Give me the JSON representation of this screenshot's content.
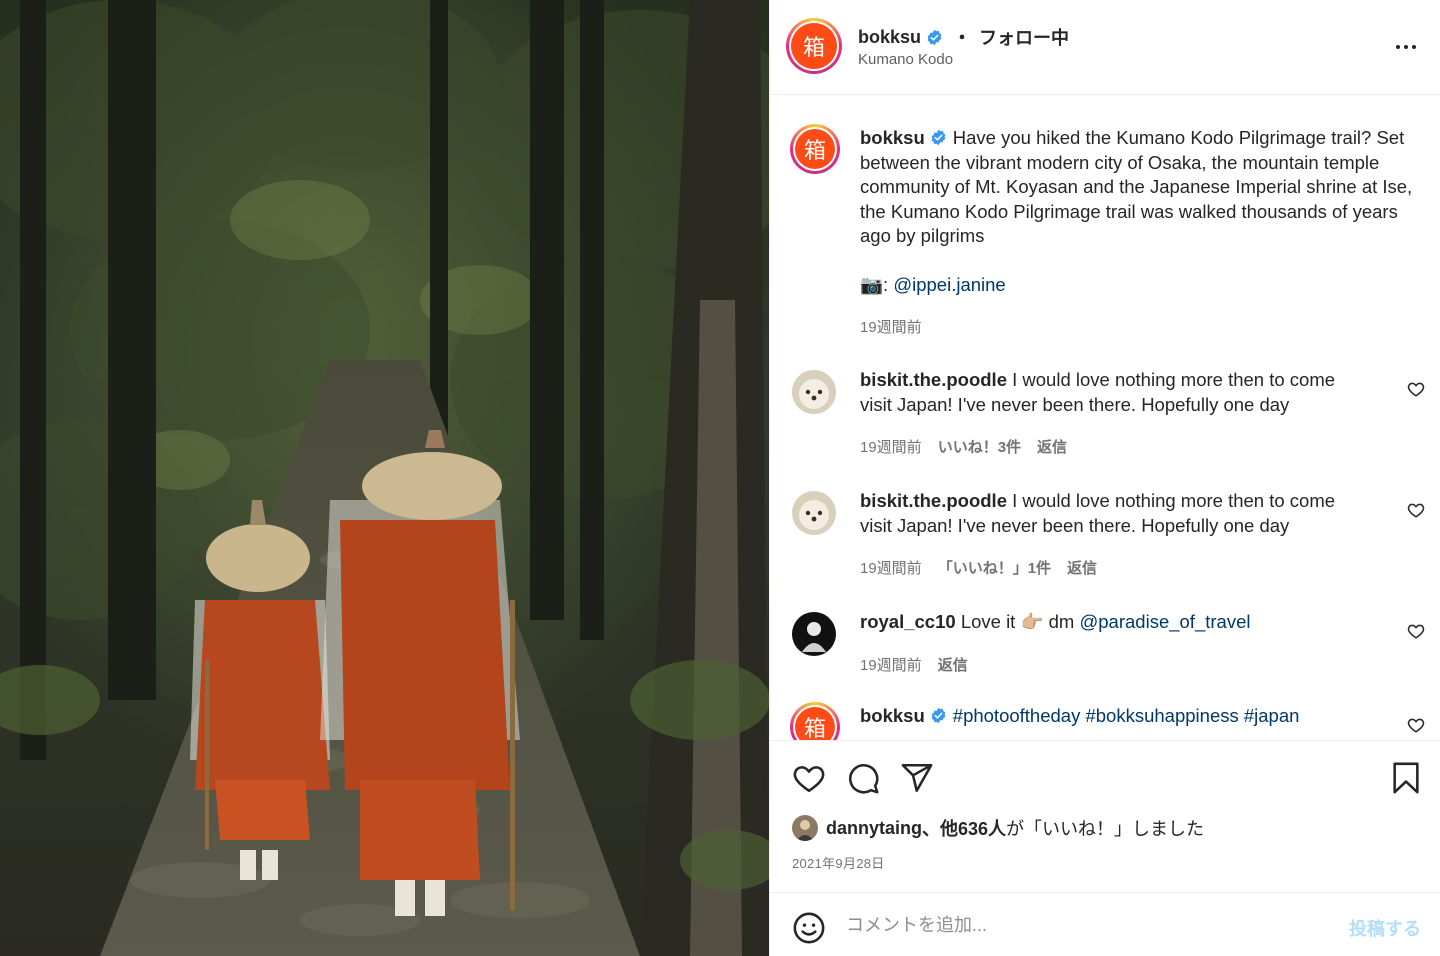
{
  "post": {
    "username": "bokksu",
    "follow_separator": "・",
    "follow_status": "フォロー中",
    "location": "Kumano Kodo",
    "avatar_glyph": "箱"
  },
  "caption": {
    "username": "bokksu",
    "text": "Have you hiked the Kumano Kodo Pilgrimage trail? Set between the vibrant modern city of Osaka, the mountain temple community of Mt. Koyasan and the Japanese Imperial shrine at Ise, the Kumano Kodo Pilgrimage trail was walked thousands of years ago by pilgrims",
    "credit_prefix": "📷: ",
    "credit_link": "@ippei.janine",
    "time": "19週間前"
  },
  "comments": [
    {
      "username": "biskit.the.poodle",
      "text": "I would love nothing more then to come visit Japan! I've never been there. Hopefully one day",
      "time": "19週間前",
      "likes": "いいね！3件",
      "reply": "返信"
    },
    {
      "username": "biskit.the.poodle",
      "text": "I would love nothing more then to come visit Japan! I've never been there. Hopefully one day",
      "time": "19週間前",
      "likes": "「いいね！」1件",
      "reply": "返信"
    },
    {
      "username": "royal_cc10",
      "text": "Love it 👉🏼 dm ",
      "link": "@paradise_of_travel",
      "time": "19週間前",
      "reply": "返信"
    },
    {
      "username": "bokksu",
      "hashtags": "#photooftheday #bokksuhappiness #japan"
    }
  ],
  "likes": {
    "user": "dannytaing",
    "others": "、他636人",
    "suffix": "が「いいね！」しました"
  },
  "date": "2021年9月28日",
  "add_comment": {
    "placeholder": "コメントを追加...",
    "post_label": "投稿する"
  },
  "icons": {
    "more": "more-horizontal-icon",
    "heart": "heart-icon",
    "comment": "comment-icon",
    "share": "paper-plane-icon",
    "save": "bookmark-icon",
    "emoji": "emoji-icon",
    "verified": "verified-badge-icon"
  },
  "colors": {
    "brand": "#ff4b16",
    "verified": "#3897f0",
    "link": "#00376b",
    "post_disabled": "#b2dffc"
  }
}
